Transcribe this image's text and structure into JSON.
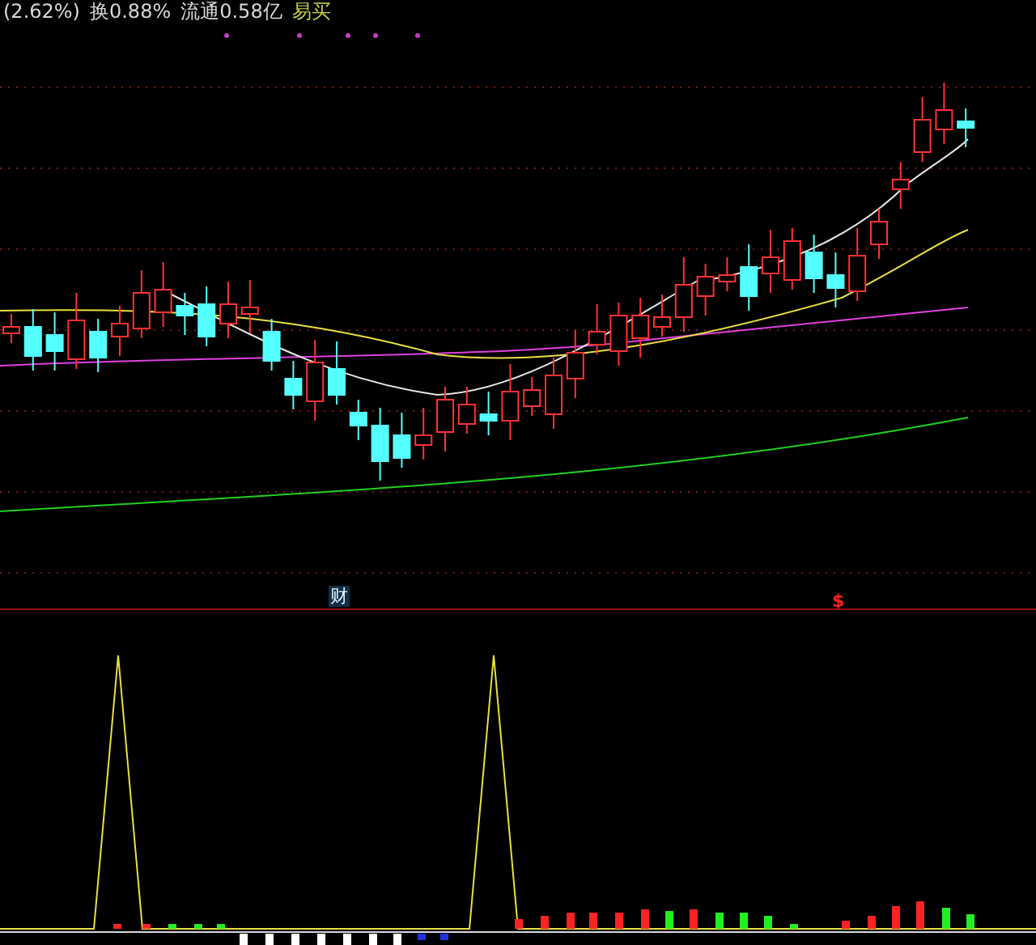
{
  "header": [
    {
      "kind": "stat",
      "text": "(2.62%)"
    },
    {
      "kind": "stat",
      "text": "换0.88%"
    },
    {
      "kind": "stat",
      "text": "流通0.58亿"
    },
    {
      "kind": "signal",
      "text": "易买"
    }
  ],
  "markers": [
    {
      "kind": "finance",
      "label": "财"
    },
    {
      "kind": "signal",
      "label": "$"
    }
  ]
}
